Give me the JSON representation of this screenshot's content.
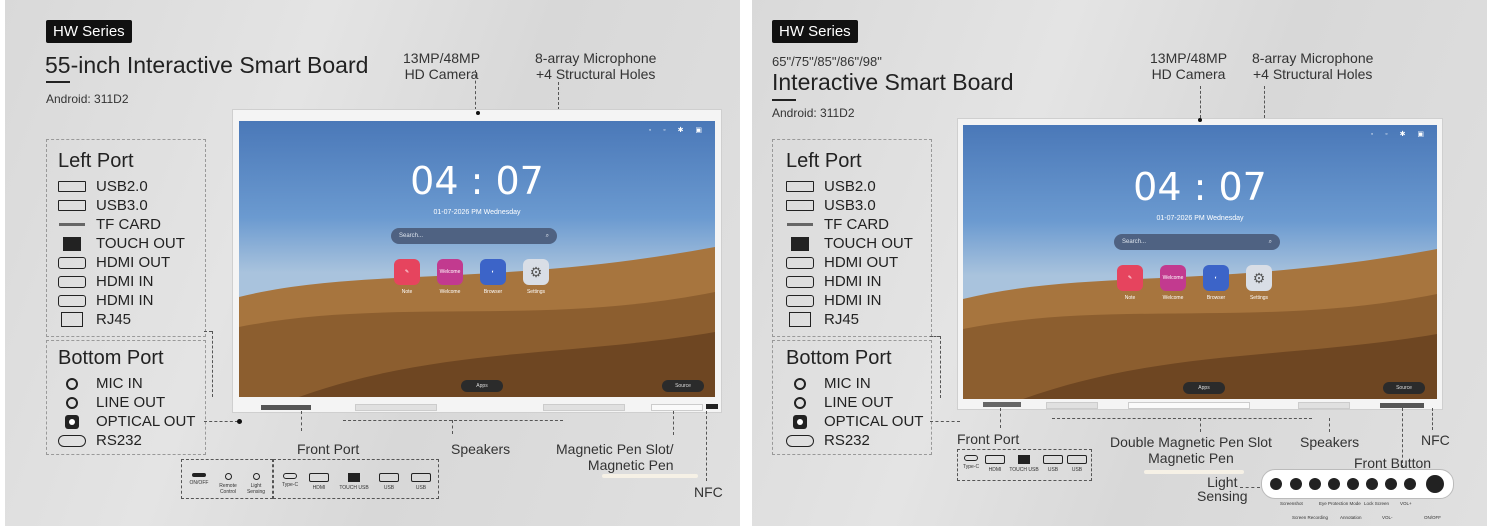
{
  "left_panel": {
    "series_badge": "HW Series",
    "title": "55-inch Interactive Smart Board",
    "android": "Android: 311D2",
    "camera": [
      "13MP/48MP",
      "HD Camera"
    ],
    "microphone": [
      "8-array Microphone",
      "+4 Structural Holes"
    ],
    "left_port": {
      "title": "Left Port",
      "items": [
        {
          "label": "USB2.0",
          "icon": "usb-icon"
        },
        {
          "label": "USB3.0",
          "icon": "usb-icon"
        },
        {
          "label": "TF CARD",
          "icon": "tf-card-icon"
        },
        {
          "label": "TOUCH OUT",
          "icon": "touch-usb-icon"
        },
        {
          "label": "HDMI OUT",
          "icon": "hdmi-icon"
        },
        {
          "label": "HDMI IN",
          "icon": "hdmi-icon"
        },
        {
          "label": "HDMI IN",
          "icon": "hdmi-icon"
        },
        {
          "label": "RJ45",
          "icon": "rj45-icon"
        }
      ]
    },
    "bottom_port": {
      "title": "Bottom Port",
      "items": [
        {
          "label": "MIC IN",
          "icon": "audio-jack-icon"
        },
        {
          "label": "LINE OUT",
          "icon": "audio-jack-icon"
        },
        {
          "label": "OPTICAL OUT",
          "icon": "optical-icon"
        },
        {
          "label": "RS232",
          "icon": "rs232-icon"
        }
      ]
    },
    "front_port_label": "Front Port",
    "speakers_label": "Speakers",
    "pen_label": [
      "Magnetic Pen Slot/",
      "Magnetic Pen"
    ],
    "nfc_label": "NFC",
    "front_controls": [
      "ON/OFF",
      "Remote Control",
      "Light Sensing"
    ],
    "front_ports": [
      "Type-C",
      "HDMI",
      "TOUCH USB",
      "USB",
      "USB"
    ]
  },
  "right_panel": {
    "series_badge": "HW Series",
    "sizes": "65\"/75\"/85\"/86\"/98\"",
    "title": "Interactive Smart Board",
    "android": "Android: 311D2",
    "camera": [
      "13MP/48MP",
      "HD Camera"
    ],
    "microphone": [
      "8-array Microphone",
      "+4 Structural Holes"
    ],
    "left_port": {
      "title": "Left Port",
      "items": [
        {
          "label": "USB2.0",
          "icon": "usb-icon"
        },
        {
          "label": "USB3.0",
          "icon": "usb-icon"
        },
        {
          "label": "TF CARD",
          "icon": "tf-card-icon"
        },
        {
          "label": "TOUCH OUT",
          "icon": "touch-usb-icon"
        },
        {
          "label": "HDMI OUT",
          "icon": "hdmi-icon"
        },
        {
          "label": "HDMI IN",
          "icon": "hdmi-icon"
        },
        {
          "label": "HDMI IN",
          "icon": "hdmi-icon"
        },
        {
          "label": "RJ45",
          "icon": "rj45-icon"
        }
      ]
    },
    "bottom_port": {
      "title": "Bottom Port",
      "items": [
        {
          "label": "MIC IN",
          "icon": "audio-jack-icon"
        },
        {
          "label": "LINE OUT",
          "icon": "audio-jack-icon"
        },
        {
          "label": "OPTICAL OUT",
          "icon": "optical-icon"
        },
        {
          "label": "RS232",
          "icon": "rs232-icon"
        }
      ]
    },
    "front_port_label": "Front Port",
    "front_ports": [
      "Type-C",
      "HDMI",
      "TOUCH USB",
      "USB",
      "USB"
    ],
    "pen_label": [
      "Double Magnetic Pen Slot",
      "Magnetic Pen"
    ],
    "speakers_label": "Speakers",
    "nfc_label": "NFC",
    "front_button_label": "Front Button",
    "light_sensing_label": [
      "Light",
      "Sensing"
    ],
    "buttons_top": [
      "Screenshot",
      "Eye Protection Mode",
      "Lock Screen",
      "VOL+"
    ],
    "buttons_bottom": [
      "Screen Recording",
      "Annotation",
      "VOL-",
      "ON/OFF"
    ]
  },
  "screen": {
    "time_h": "04",
    "time_m": "07",
    "date": "01-07-2026  PM Wednesday",
    "search_placeholder": "Search...",
    "apps": [
      {
        "label": "Note",
        "color": "#e6445e",
        "icon": "pen-app-icon"
      },
      {
        "label": "Welcome",
        "color": "#c23a8f",
        "tile_text": "Welcome",
        "icon": "welcome-app-icon"
      },
      {
        "label": "Browser",
        "color": "#3c64c8",
        "icon": "planet-app-icon"
      },
      {
        "label": "Settings",
        "color": "#d9dee6",
        "icon": "gear-icon"
      }
    ],
    "apps_button": "Apps",
    "source_button": "Source",
    "status_icons": [
      "network-icon",
      "wifi-icon",
      "bluetooth-icon",
      "calendar-icon"
    ]
  }
}
